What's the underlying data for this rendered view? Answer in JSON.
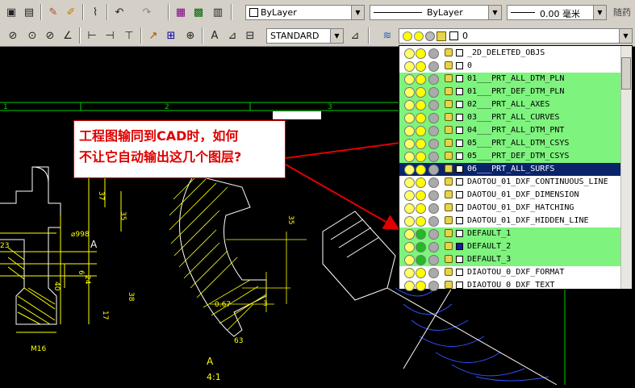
{
  "toolbar1": {
    "color_combo": "ByLayer",
    "linetype_combo": "ByLayer",
    "lineweight_combo": "0.00 毫米",
    "random_label": "随药"
  },
  "toolbar2": {
    "dimstyle_combo": "STANDARD",
    "current_layer": "0"
  },
  "drawing": {
    "grid_labels": [
      "1",
      "2",
      "3"
    ],
    "view_label": "A",
    "scale_label": "4:1",
    "dims": [
      "37",
      "35",
      "35",
      "⌀998",
      "23",
      "40",
      "6",
      "24",
      "17",
      "38",
      "M16",
      "0.67",
      "3",
      "63",
      "A"
    ]
  },
  "callout": {
    "line1": "工程图输同到CAD时，如何",
    "line2": "不让它自动输出这几个图层?"
  },
  "layers": [
    {
      "name": "_2D_DELETED_OBJS",
      "hl": false,
      "sel": false,
      "sw": "#ffffff",
      "on_color": "#ffff00"
    },
    {
      "name": "0",
      "hl": false,
      "sel": false,
      "sw": "#ffffff",
      "on_color": "#ffff00"
    },
    {
      "name": "01___PRT_ALL_DTM_PLN",
      "hl": true,
      "sel": false,
      "sw": "#ffffff",
      "on_color": "#ffff00"
    },
    {
      "name": "01___PRT_DEF_DTM_PLN",
      "hl": true,
      "sel": false,
      "sw": "#ffffff",
      "on_color": "#ffff00"
    },
    {
      "name": "02___PRT_ALL_AXES",
      "hl": true,
      "sel": false,
      "sw": "#ffffff",
      "on_color": "#ffff00"
    },
    {
      "name": "03___PRT_ALL_CURVES",
      "hl": true,
      "sel": false,
      "sw": "#ffffff",
      "on_color": "#ffff00"
    },
    {
      "name": "04___PRT_ALL_DTM_PNT",
      "hl": true,
      "sel": false,
      "sw": "#ffffff",
      "on_color": "#ffff00"
    },
    {
      "name": "05___PRT_ALL_DTM_CSYS",
      "hl": true,
      "sel": false,
      "sw": "#ffffff",
      "on_color": "#ffff00"
    },
    {
      "name": "05___PRT_DEF_DTM_CSYS",
      "hl": true,
      "sel": false,
      "sw": "#ffffff",
      "on_color": "#ffff00"
    },
    {
      "name": "06___PRT_ALL_SURFS",
      "hl": false,
      "sel": true,
      "sw": "#ffffff",
      "on_color": "#ffff00"
    },
    {
      "name": "DAOTOU_01_DXF_CONTINUOUS_LINE",
      "hl": false,
      "sel": false,
      "sw": "#ffffff",
      "on_color": "#ffff00"
    },
    {
      "name": "DAOTOU_01_DXF_DIMENSION",
      "hl": false,
      "sel": false,
      "sw": "#ffffff",
      "on_color": "#ffff00"
    },
    {
      "name": "DAOTOU_01_DXF_HATCHING",
      "hl": false,
      "sel": false,
      "sw": "#ffffff",
      "on_color": "#ffff00"
    },
    {
      "name": "DAOTOU_01_DXF_HIDDEN_LINE",
      "hl": false,
      "sel": false,
      "sw": "#ffffff",
      "on_color": "#ffff00"
    },
    {
      "name": "DEFAULT_1",
      "hl": true,
      "sel": false,
      "sw": "#ffffff",
      "on_color": "#22bb22"
    },
    {
      "name": "DEFAULT_2",
      "hl": true,
      "sel": false,
      "sw": "#1a1a9a",
      "on_color": "#22bb22"
    },
    {
      "name": "DEFAULT_3",
      "hl": true,
      "sel": false,
      "sw": "#ffffff",
      "on_color": "#22bb22"
    },
    {
      "name": "DIAOTOU_0_DXF_FORMAT",
      "hl": false,
      "sel": false,
      "sw": "#ffffff",
      "on_color": "#ffff00"
    },
    {
      "name": "DIAOTOU_0_DXF_TEXT",
      "hl": false,
      "sel": false,
      "sw": "#ffffff",
      "on_color": "#ffff00"
    }
  ]
}
